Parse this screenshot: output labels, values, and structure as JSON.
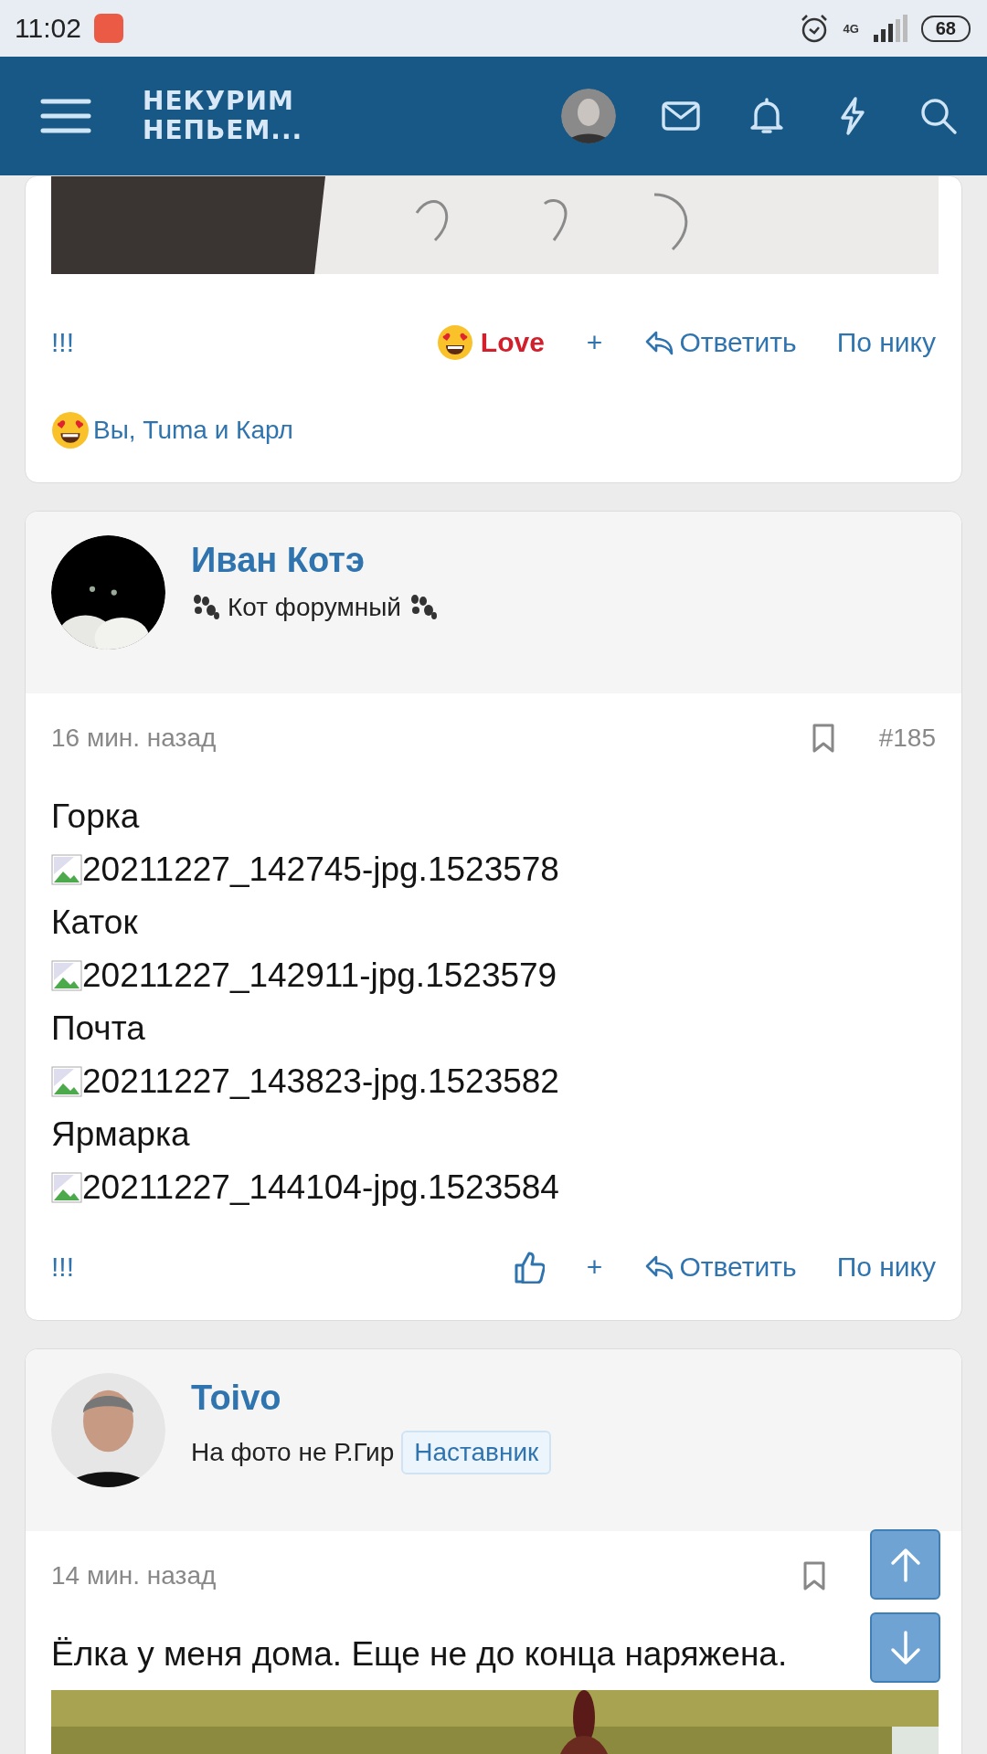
{
  "status_bar": {
    "time": "11:02",
    "network": "4G",
    "battery": "68"
  },
  "header": {
    "logo_lines": [
      "НЕКУРИМ",
      "НЕПЬЕМ..."
    ]
  },
  "posts": [
    {
      "kind": "tail",
      "footer": {
        "left": "!!!",
        "reaction": {
          "kind": "love",
          "label": "Love",
          "selected": true
        },
        "plus": "+",
        "reply": "Ответить",
        "quote": "По нику"
      },
      "reactions_text": "Вы, Tuma и Карл"
    },
    {
      "kind": "full",
      "author": {
        "name": "Иван Котэ",
        "avatar": {
          "kind": "cat"
        },
        "title": "Кот форумный",
        "paws": true
      },
      "time": "16 мин. назад",
      "number": "#185",
      "body": [
        {
          "kind": "text",
          "text": "Горка"
        },
        {
          "kind": "broken_image",
          "text": "20211227_142745-jpg.1523578"
        },
        {
          "kind": "text",
          "text": "Каток"
        },
        {
          "kind": "broken_image",
          "text": "20211227_142911-jpg.1523579"
        },
        {
          "kind": "text",
          "text": "Почта"
        },
        {
          "kind": "broken_image",
          "text": "20211227_143823-jpg.1523582"
        },
        {
          "kind": "text",
          "text": "Ярмарка"
        },
        {
          "kind": "broken_image",
          "text": "20211227_144104-jpg.1523584"
        }
      ],
      "footer": {
        "left": "!!!",
        "reaction": {
          "kind": "like",
          "selected": false
        },
        "plus": "+",
        "reply": "Ответить",
        "quote": "По нику"
      }
    },
    {
      "kind": "full",
      "author": {
        "name": "Toivo",
        "avatar": {
          "kind": "person"
        },
        "title": "На фото не Р.Гир",
        "paws": false,
        "badge": "Наставник"
      },
      "time": "14 мин. назад",
      "body": [
        {
          "kind": "text",
          "text": "Ёлка у меня дома. Еще не до конца наряжена."
        },
        {
          "kind": "picture"
        }
      ]
    }
  ]
}
